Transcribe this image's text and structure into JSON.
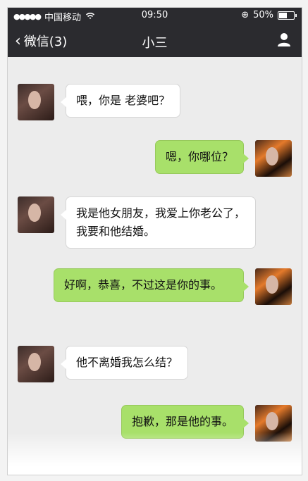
{
  "status_bar": {
    "signal": "●●●●●",
    "carrier": "中国移动",
    "wifi_icon": "wifi-icon",
    "time": "09:50",
    "battery_percent": "50%"
  },
  "nav": {
    "back_label": "微信(3)",
    "title": "小三"
  },
  "messages": [
    {
      "side": "left",
      "text": "喂，你是  老婆吧？"
    },
    {
      "side": "right",
      "text": "嗯，你哪位？"
    },
    {
      "side": "left",
      "text": "我是他女朋友，我爱上你老公了，我要和他结婚。"
    },
    {
      "side": "right",
      "text": "好啊，恭喜，不过这是你的事。"
    },
    {
      "side": "left",
      "text": "他不离婚我怎么结？"
    },
    {
      "side": "right",
      "text": "抱歉，那是他的事。"
    }
  ]
}
